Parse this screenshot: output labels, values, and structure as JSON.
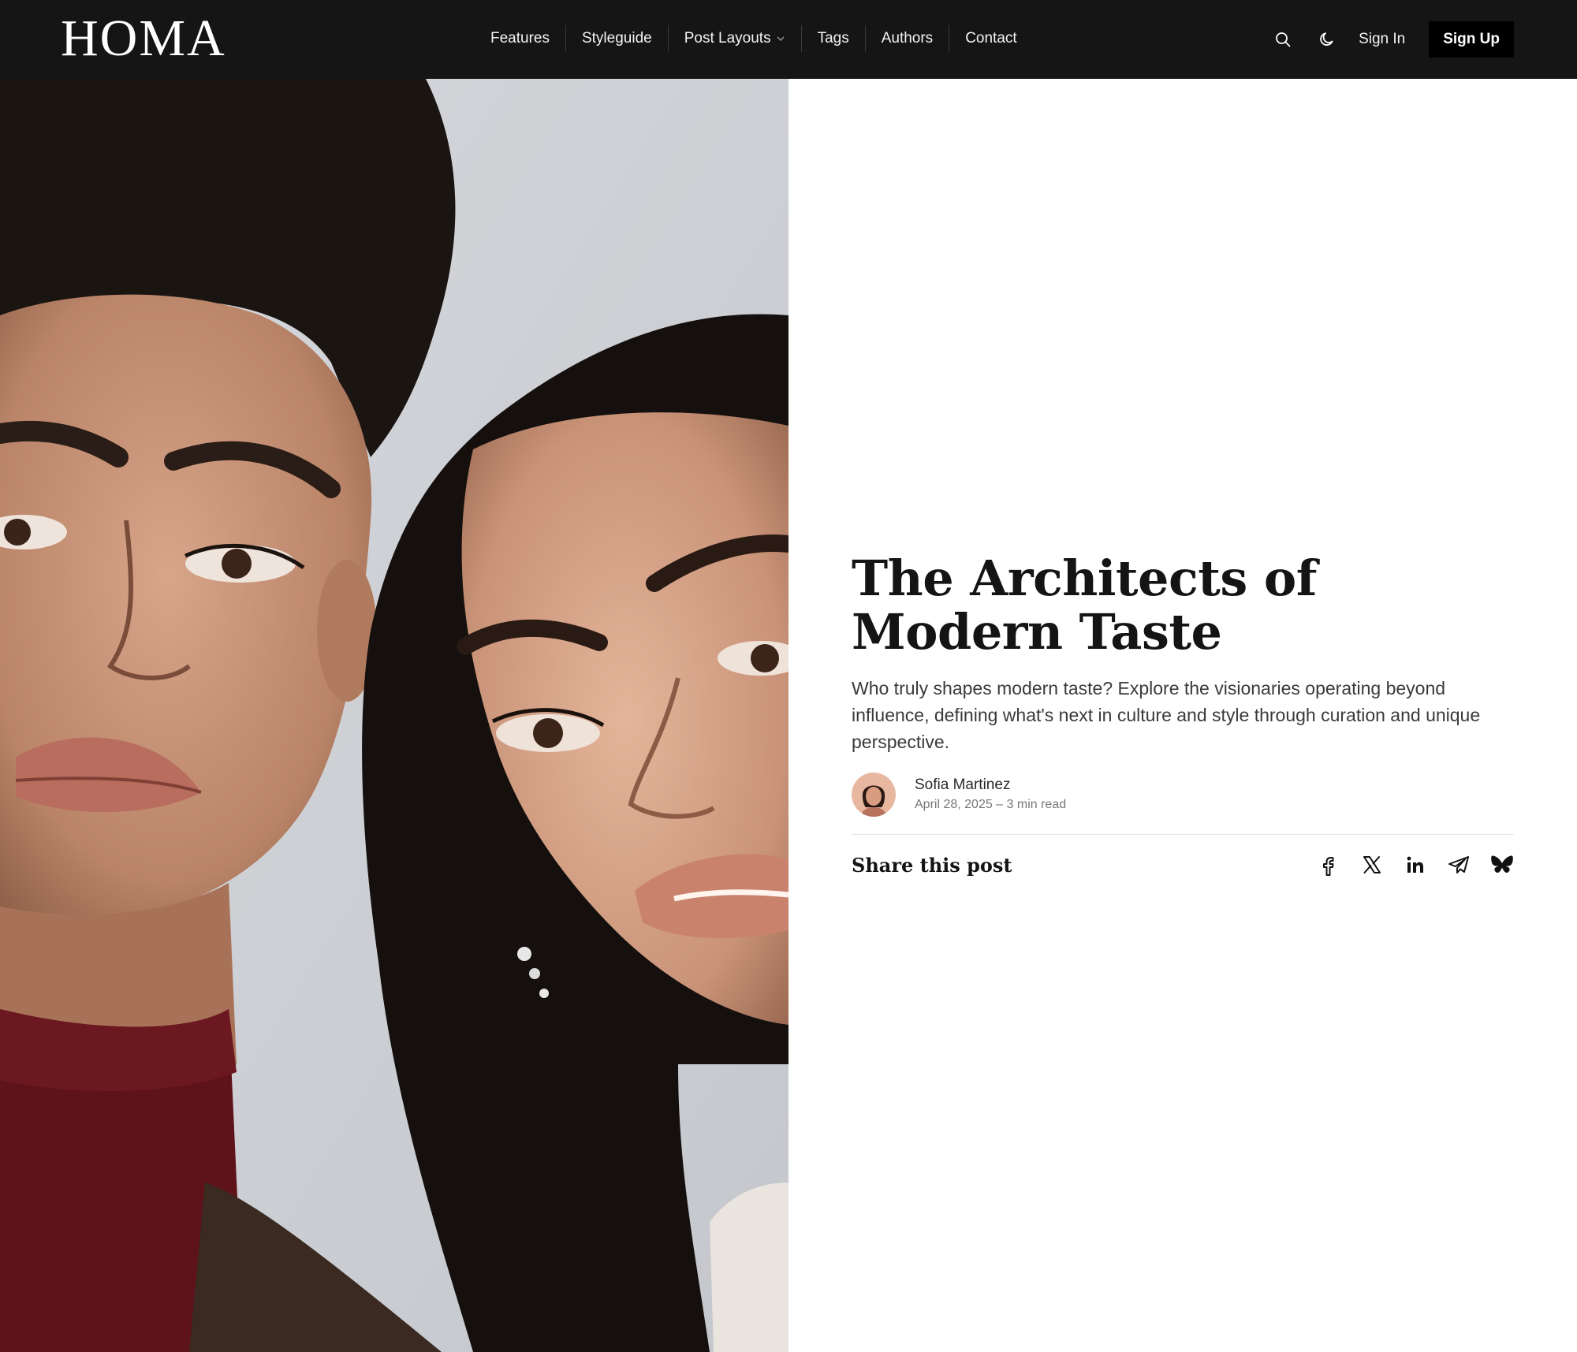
{
  "site": {
    "logo": "HOMA"
  },
  "nav": {
    "items": [
      {
        "label": "Features"
      },
      {
        "label": "Styleguide"
      },
      {
        "label": "Post Layouts"
      },
      {
        "label": "Tags"
      },
      {
        "label": "Authors"
      },
      {
        "label": "Contact"
      }
    ]
  },
  "header": {
    "search_icon": "search-icon",
    "theme_icon": "moon-icon",
    "signin_label": "Sign In",
    "signup_label": "Sign Up"
  },
  "post": {
    "title": "The Architects of Modern Taste",
    "excerpt": "Who truly shapes modern taste? Explore the visionaries operating beyond influence, defining what's next in culture and style through curation and unique perspective.",
    "author": "Sofia Martinez",
    "meta": "April 28, 2025 – 3 min read",
    "share_label": "Share this post",
    "share_icons": [
      "facebook-icon",
      "x-icon",
      "linkedin-icon",
      "telegram-icon",
      "bluesky-icon"
    ]
  },
  "colors": {
    "header_bg": "#151515",
    "signup_bg": "#000000",
    "text_dark": "#141414",
    "text_muted": "#777777"
  }
}
